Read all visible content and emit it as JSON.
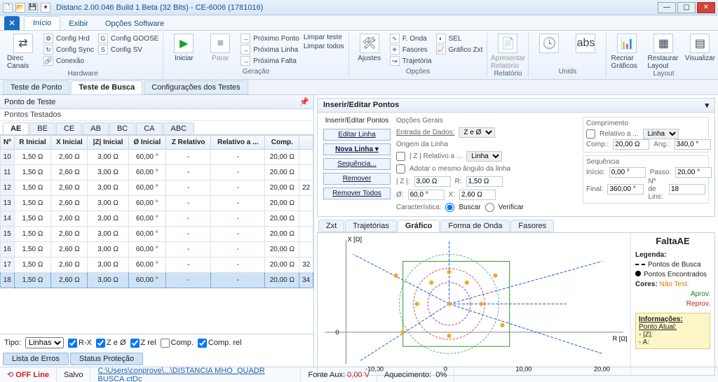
{
  "window": {
    "title": "Distanc 2.00.046 Build 1 Beta (32 Bits) - CE-6006 (1781016)"
  },
  "ribbon": {
    "tabs": [
      "Início",
      "Exibir",
      "Opções Software"
    ],
    "active_tab": "Início",
    "groups": {
      "hardware": {
        "label": "Hardware",
        "direc_canais": "Direc Canais",
        "items": [
          "Config Hrd",
          "Config Sync",
          "Conexão",
          "Config GOOSE",
          "Config SV"
        ]
      },
      "geracao": {
        "label": "Geração",
        "iniciar": "Iniciar",
        "parar": "Parar",
        "items": [
          "Próximo Ponto",
          "Próxima Linha",
          "Próxima Falta",
          "Limpar teste",
          "Limpar todos"
        ]
      },
      "opcoes": {
        "label": "Opções",
        "ajustes": "Ajustes",
        "items": [
          "F. Onda",
          "Fasores",
          "Trajetória",
          "SEL",
          "Gráfico Zxt"
        ]
      },
      "relatorio": {
        "label": "Relatório",
        "btn": "Apresentar Relatório"
      },
      "unids": {
        "label": "Unids"
      },
      "layout": {
        "label": "Layout",
        "recriar": "Recriar Gráficos",
        "restaurar": "Restaurar Layout",
        "visualizar": "Visualizar"
      }
    }
  },
  "doc_tabs": {
    "items": [
      "Teste de Ponto",
      "Teste de Busca",
      "Configurações dos Testes"
    ],
    "active": "Teste de Busca"
  },
  "left": {
    "pane_title": "Ponto de Teste",
    "pane_sub": "Pontos Testados",
    "phase_tabs": [
      "AE",
      "BE",
      "CE",
      "AB",
      "BC",
      "CA",
      "ABC"
    ],
    "phase_active": "AE",
    "columns": [
      "Nº",
      "R Inicial",
      "X Inicial",
      "|Z| Inicial",
      "Ø Inicial",
      "Z Relativo",
      "Relativo a ...",
      "Comp.",
      ""
    ],
    "rows": [
      {
        "n": "10",
        "r": "1,50 Ω",
        "x": "2,60 Ω",
        "z": "3,00 Ω",
        "o": "60,00 °",
        "zr": "-",
        "rel": "-",
        "comp": "20,00 Ω",
        "ext": ""
      },
      {
        "n": "11",
        "r": "1,50 Ω",
        "x": "2,60 Ω",
        "z": "3,00 Ω",
        "o": "60,00 °",
        "zr": "-",
        "rel": "-",
        "comp": "20,00 Ω",
        "ext": ""
      },
      {
        "n": "12",
        "r": "1,50 Ω",
        "x": "2,60 Ω",
        "z": "3,00 Ω",
        "o": "60,00 °",
        "zr": "-",
        "rel": "-",
        "comp": "20,00 Ω",
        "ext": "22"
      },
      {
        "n": "13",
        "r": "1,50 Ω",
        "x": "2,60 Ω",
        "z": "3,00 Ω",
        "o": "60,00 °",
        "zr": "-",
        "rel": "-",
        "comp": "20,00 Ω",
        "ext": ""
      },
      {
        "n": "14",
        "r": "1,50 Ω",
        "x": "2,60 Ω",
        "z": "3,00 Ω",
        "o": "60,00 °",
        "zr": "-",
        "rel": "-",
        "comp": "20,00 Ω",
        "ext": ""
      },
      {
        "n": "15",
        "r": "1,50 Ω",
        "x": "2,60 Ω",
        "z": "3,00 Ω",
        "o": "60,00 °",
        "zr": "-",
        "rel": "-",
        "comp": "20,00 Ω",
        "ext": ""
      },
      {
        "n": "16",
        "r": "1,50 Ω",
        "x": "2,60 Ω",
        "z": "3,00 Ω",
        "o": "60,00 °",
        "zr": "-",
        "rel": "-",
        "comp": "20,00 Ω",
        "ext": ""
      },
      {
        "n": "17",
        "r": "1,50 Ω",
        "x": "2,60 Ω",
        "z": "3,00 Ω",
        "o": "60,00 °",
        "zr": "-",
        "rel": "-",
        "comp": "20,00 Ω",
        "ext": "32"
      },
      {
        "n": "18",
        "r": "1,50 Ω",
        "x": "2,60 Ω",
        "z": "3,00 Ω",
        "o": "60,00 °",
        "zr": "-",
        "rel": "-",
        "comp": "20,00 Ω",
        "ext": "34"
      }
    ],
    "selected_row": "18",
    "filters": {
      "tipo_lbl": "Tipo:",
      "tipo_val": "Linhas",
      "checks": [
        "R-X",
        "Z e Ø",
        "Z rel",
        "Comp.",
        "Comp. rel"
      ]
    },
    "bottom_tabs": [
      "Lista de Erros",
      "Status Proteção"
    ]
  },
  "right": {
    "editor": {
      "title": "Inserir/Editar Pontos",
      "sub": "Inserir/Editar Pontos",
      "buttons": [
        "Editar Linha",
        "Nova Linha",
        "Sequência...",
        "Remover",
        "Remover Todos"
      ],
      "opcoes_lbl": "Opções Gerais",
      "entrada_lbl": "Entrada de Dados:",
      "entrada_val": "Z e Ø",
      "origem_lbl": "Origem da Linha",
      "zrel_lbl": "| Z | Relativo a ...",
      "zrel_val": "Linha",
      "adotar_lbl": "Adotar o mesmo ângulo da linha",
      "z_lbl": "| Z |:",
      "z_val": "3,00 Ω",
      "r_lbl": "R:",
      "r_val": "1,50 Ω",
      "o_lbl": "Ø:",
      "o_val": "60,0 °",
      "x_lbl": "X:",
      "x_val": "2,60 Ω",
      "caract_lbl": "Característica:",
      "buscar": "Buscar",
      "verificar": "Verificar",
      "comprim_lbl": "Comprimento",
      "relativo_lbl": "Relativo a ...",
      "relativo_val": "Linha",
      "comp_lbl": "Comp.:",
      "comp_val": "20,00 Ω",
      "ang_lbl": "Ang.:",
      "ang_val": "340,0 °",
      "seq_lbl": "Sequência",
      "inicio_lbl": "Início:",
      "inicio_val": "0,00 °",
      "passo_lbl": "Passo:",
      "passo_val": "20,00 °",
      "final_lbl": "Final:",
      "final_val": "360,00 °",
      "nlins_lbl": "Nº de Lins:",
      "nlins_val": "18"
    },
    "graph_tabs": [
      "Zxt",
      "Trajetórias",
      "Gráfico",
      "Forma de Onda",
      "Fasores"
    ],
    "graph_active": "Gráfico",
    "graph": {
      "xlabel": "R [Ω]",
      "ylabel": "X [Ω]",
      "xticks": [
        "-10,00",
        "0",
        "10,00",
        "20,00"
      ],
      "ytick0": "0"
    },
    "legend": {
      "title": "FaltaAE",
      "legenda_lbl": "Legenda:",
      "busca": "Pontos de Busca",
      "encontrados": "Pontos Encontrados",
      "cores_lbl": "Cores:",
      "nt": "Não Test.",
      "ap": "Aprov.",
      "rp": "Reprov.",
      "info_hd": "Informações:",
      "ponto_lbl": "Ponto Atual:",
      "z_lbl": "- |Z|:",
      "a_lbl": "- A:"
    }
  },
  "status": {
    "online": "OFF Line",
    "salvo": "Salvo",
    "path": "C:\\Users\\conprove\\...\\DISTANCIA MHO_QUADR BUSCA.ctDc",
    "fonte": "Fonte Aux:",
    "fonte_v": "0,00 V",
    "aquec": "Aquecimento:",
    "aquec_v": "0%"
  }
}
